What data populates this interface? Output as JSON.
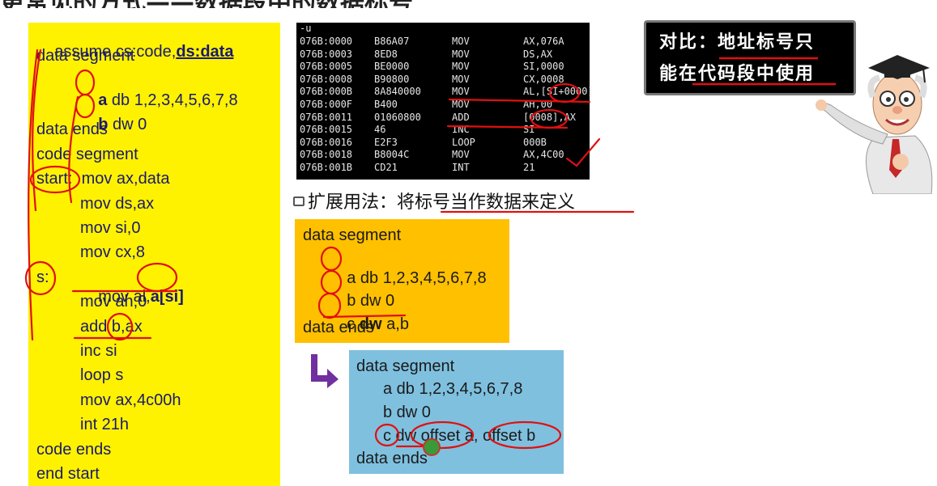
{
  "slide": {
    "title": "更常见的方式——数据段中的数据标号"
  },
  "left_code": {
    "lines": [
      {
        "text": "assume cs:code,",
        "bold_part": "ds:data"
      },
      {
        "text": "data segment"
      },
      {
        "label": "a",
        "rest": " db 1,2,3,4,5,6,7,8"
      },
      {
        "label": "b",
        "rest": " dw 0"
      },
      {
        "text": "data ends"
      },
      {
        "text": "code segment"
      },
      {
        "text": "start:  mov ax,data"
      },
      {
        "text": "mov ds,ax"
      },
      {
        "text": "mov si,0"
      },
      {
        "text": "mov cx,8"
      },
      {
        "label_s": "s:",
        "instr": "mov al,",
        "operand": "a[si]"
      },
      {
        "text": "mov ah,0"
      },
      {
        "text": "add b,ax"
      },
      {
        "text": "inc si"
      },
      {
        "text": "loop s"
      },
      {
        "text": "mov ax,4c00h"
      },
      {
        "text": "int 21h"
      },
      {
        "text": "code ends"
      },
      {
        "text": "end start"
      }
    ]
  },
  "terminal": {
    "prompt": "-u",
    "rows": [
      {
        "addr": "076B:0000",
        "hex": "B86A07",
        "op": "MOV",
        "arg": "AX,076A"
      },
      {
        "addr": "076B:0003",
        "hex": "8ED8",
        "op": "MOV",
        "arg": "DS,AX"
      },
      {
        "addr": "076B:0005",
        "hex": "BE0000",
        "op": "MOV",
        "arg": "SI,0000"
      },
      {
        "addr": "076B:0008",
        "hex": "B90800",
        "op": "MOV",
        "arg": "CX,0008"
      },
      {
        "addr": "076B:000B",
        "hex": "8A840000",
        "op": "MOV",
        "arg": "AL,[SI+0000]"
      },
      {
        "addr": "076B:000F",
        "hex": "B400",
        "op": "MOV",
        "arg": "AH,00"
      },
      {
        "addr": "076B:0011",
        "hex": "01060800",
        "op": "ADD",
        "arg": "[0008],AX"
      },
      {
        "addr": "076B:0015",
        "hex": "46",
        "op": "INC",
        "arg": "SI"
      },
      {
        "addr": "076B:0016",
        "hex": "E2F3",
        "op": "LOOP",
        "arg": "000B"
      },
      {
        "addr": "076B:0018",
        "hex": "B8004C",
        "op": "MOV",
        "arg": "AX,4C00"
      },
      {
        "addr": "076B:001B",
        "hex": "CD21",
        "op": "INT",
        "arg": "21"
      }
    ]
  },
  "extension": {
    "heading": "扩展用法：将标号当作数据来定义"
  },
  "orange_box": {
    "line1": "data segment",
    "line2_label": "a",
    "line2_rest": " db 1,2,3,4,5,6,7,8",
    "line3_label": "b",
    "line3_rest": " dw 0",
    "line4_label": "c",
    "line4_kw": "dw",
    "line4_rest": " a,b",
    "line5": "data ends"
  },
  "blue_box": {
    "line1": "data segment",
    "line2": "a db 1,2,3,4,5,6,7,8",
    "line3": "b dw 0",
    "line4": "c dw offset a, offset b",
    "line5": "data ends"
  },
  "callout": {
    "line1": "对比：地址标号只",
    "line2": "能在代码段中使用"
  },
  "colors": {
    "yellow_panel": "#fff200",
    "orange_box": "#ffc000",
    "blue_box": "#7fc0df",
    "annotation_red": "#e01010",
    "arrow_purple": "#7030a0"
  }
}
